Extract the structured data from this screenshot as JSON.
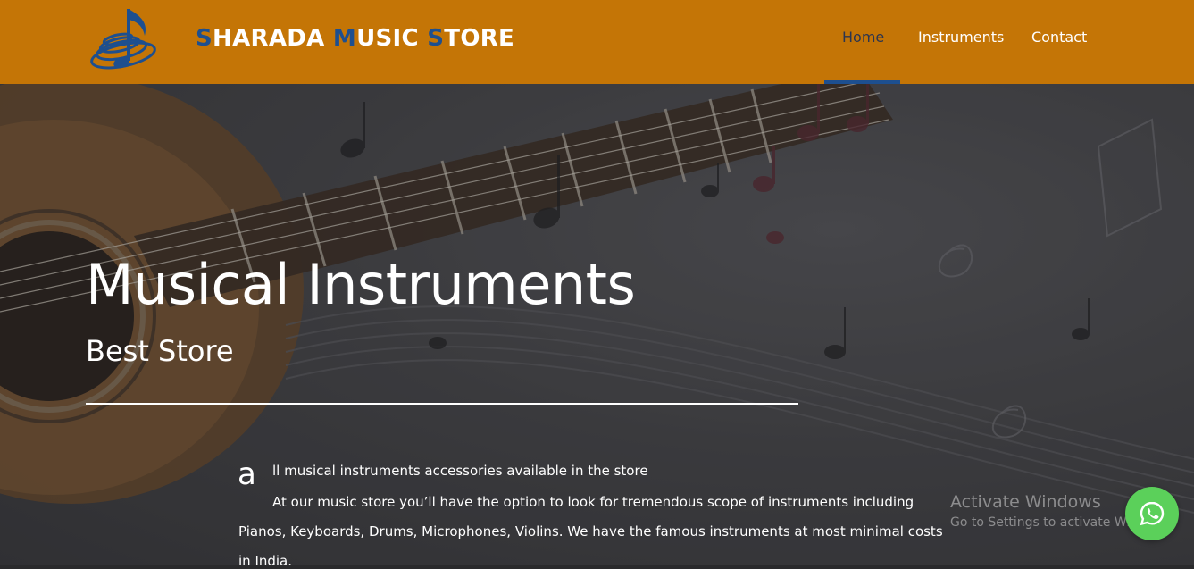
{
  "header": {
    "brand": {
      "word1_initial": "S",
      "word1_rest": "HARADA ",
      "word2_initial": "M",
      "word2_rest": "USIC ",
      "word3_initial": "S",
      "word3_rest": "TORE"
    },
    "logo_icon": "music-note-logo-icon",
    "nav": [
      {
        "label": "Home",
        "active": true
      },
      {
        "label": "Instruments",
        "active": false
      },
      {
        "label": "Contact",
        "active": false
      }
    ]
  },
  "hero": {
    "title": "Musical Instruments",
    "subtitle": "Best Store",
    "dropcap": "a",
    "first_line": "ll musical instruments accessories available in the store",
    "paragraph": "At our music store you’ll have the option to look for tremendous scope of instruments including Pianos, Keyboards, Drums, Microphones, Violins. We have the famous instruments at most minimal costs in India."
  },
  "watermark": {
    "title": "Activate Windows",
    "subtitle": "Go to Settings to activate Windows."
  },
  "whatsapp": {
    "icon": "whatsapp-icon"
  },
  "colors": {
    "header_bg": "#c47506",
    "brand_accent": "#1d4f8f",
    "whatsapp": "#5bd05a"
  }
}
